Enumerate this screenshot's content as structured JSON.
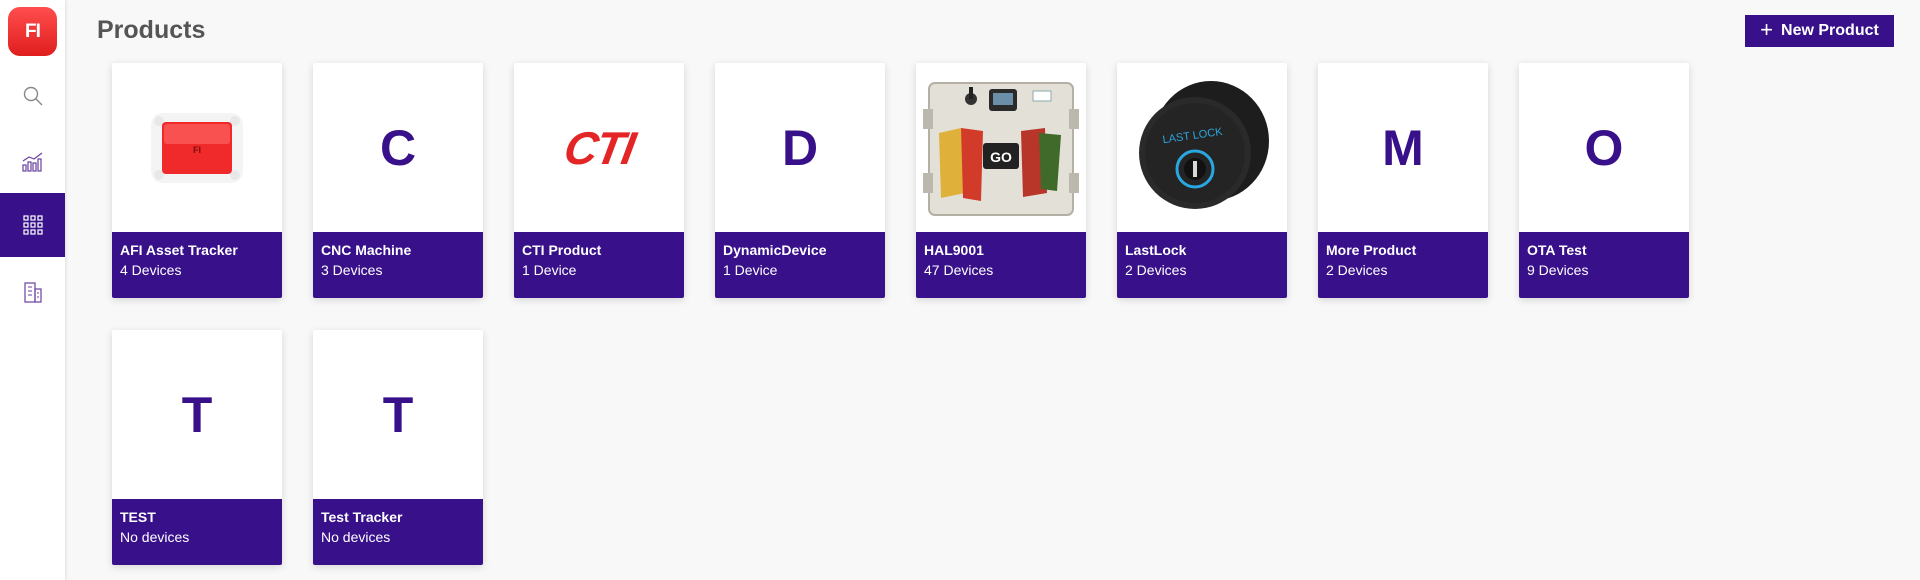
{
  "app": {
    "logo_text": "FI",
    "nav": [
      {
        "name": "search",
        "icon": "search-icon",
        "active": false
      },
      {
        "name": "analytics",
        "icon": "chart-icon",
        "active": false
      },
      {
        "name": "products",
        "icon": "grid-icon",
        "active": true
      },
      {
        "name": "buildings",
        "icon": "building-icon",
        "active": false
      }
    ]
  },
  "header": {
    "title": "Products",
    "new_button_label": "New Product",
    "new_button_icon": "plus-icon"
  },
  "products": [
    {
      "name": "AFI Asset Tracker",
      "count": "4 Devices",
      "image": "red-tracker-device",
      "initial": ""
    },
    {
      "name": "CNC Machine",
      "count": "3 Devices",
      "initial": "C"
    },
    {
      "name": "CTI Product",
      "count": "1 Device",
      "image": "cti-logo",
      "logo_text": "CTI",
      "initial": ""
    },
    {
      "name": "DynamicDevice",
      "count": "1 Device",
      "initial": "D"
    },
    {
      "name": "HAL9001",
      "count": "47 Devices",
      "image": "enclosure-box",
      "initial": ""
    },
    {
      "name": "LastLock",
      "count": "2 Devices",
      "image": "lock-device",
      "logo_text": "LAST LOCK",
      "initial": ""
    },
    {
      "name": "More Product",
      "count": "2 Devices",
      "initial": "M"
    },
    {
      "name": "OTA Test",
      "count": "9 Devices",
      "initial": "O"
    },
    {
      "name": "TEST",
      "count": "No devices",
      "initial": "T"
    },
    {
      "name": "Test Tracker",
      "count": "No devices",
      "initial": "T"
    }
  ],
  "colors": {
    "accent": "#37108a",
    "logo_red": "#f0282d",
    "background": "#f8f8f8",
    "title_gray": "#555555"
  }
}
